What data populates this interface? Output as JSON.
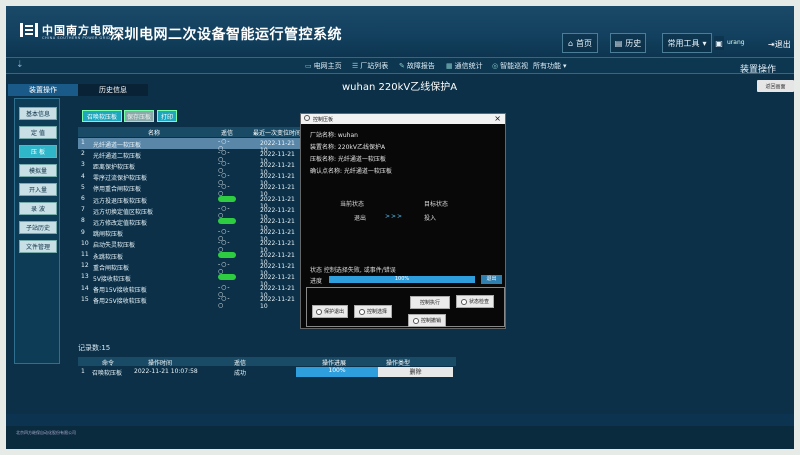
{
  "header": {
    "logo_cn": "中国南方电网",
    "logo_en": "CHINA SOUTHERN POWER GRID",
    "system_title": "深圳电网二次设备智能运行管控系统",
    "home": "首页",
    "history": "历史",
    "common_tools": "常用工具",
    "user": "urang",
    "exit": "退出"
  },
  "menubar": {
    "items": [
      "电网主页",
      "厂站列表",
      "故障报告",
      "通信统计",
      "智能巡视",
      "所有功能"
    ]
  },
  "page": {
    "title": "wuhan 220kV乙线保护A",
    "ops_title": "装置操作",
    "return": "返回画面",
    "tabs": [
      "装置操作",
      "历史信息"
    ]
  },
  "leftnav": {
    "items": [
      "基本信息",
      "定 值",
      "压 板",
      "模拟量",
      "开入量",
      "录 波",
      "子站历史",
      "文件管理"
    ],
    "active_index": 2
  },
  "actions": [
    "召唤软压板",
    "保存压板",
    "打印"
  ],
  "grid": {
    "headers": [
      "名称",
      "遥信",
      "最近一次变位时间"
    ],
    "rows": [
      {
        "num": "1",
        "name": "光纤通道一软压板",
        "state": "off",
        "time": "2022-11-21 10"
      },
      {
        "num": "2",
        "name": "光纤通道二软压板",
        "state": "off",
        "time": "2022-11-21 10"
      },
      {
        "num": "3",
        "name": "距离保护软压板",
        "state": "off",
        "time": "2022-11-21 10"
      },
      {
        "num": "4",
        "name": "零序过流保护软压板",
        "state": "off",
        "time": "2022-11-21 10"
      },
      {
        "num": "5",
        "name": "停用重合闸软压板",
        "state": "off",
        "time": "2022-11-21 10"
      },
      {
        "num": "6",
        "name": "远方投退压板软压板",
        "state": "on",
        "time": "2022-11-21 10"
      },
      {
        "num": "7",
        "name": "远方切换定值区软压板",
        "state": "off",
        "time": "2022-11-21 10"
      },
      {
        "num": "8",
        "name": "远方修改定值软压板",
        "state": "on",
        "time": "2022-11-21 10"
      },
      {
        "num": "9",
        "name": "跳闸软压板",
        "state": "off",
        "time": "2022-11-21 10"
      },
      {
        "num": "10",
        "name": "启动失灵软压板",
        "state": "off",
        "time": "2022-11-21 10"
      },
      {
        "num": "11",
        "name": "永跳软压板",
        "state": "on",
        "time": "2022-11-21 10"
      },
      {
        "num": "12",
        "name": "重合闸软压板",
        "state": "off",
        "time": "2022-11-21 10"
      },
      {
        "num": "13",
        "name": "5V接收软压板",
        "state": "on",
        "time": "2022-11-21 10"
      },
      {
        "num": "14",
        "name": "备用15V接收软压板",
        "state": "off",
        "time": "2022-11-21 10"
      },
      {
        "num": "15",
        "name": "备用25V接收软压板",
        "state": "off",
        "time": "2022-11-21 10"
      }
    ]
  },
  "log": {
    "record_count": "记录数:15",
    "headers": [
      "命令",
      "操作时间",
      "遥信",
      "操作进展",
      "操作类型"
    ],
    "row": {
      "num": "1",
      "cmd": "召唤软压板",
      "time": "2022-11-21 10:07:58",
      "result": "成功",
      "progress": "100%",
      "type": "删除"
    }
  },
  "dialog": {
    "title": "控制压板",
    "lines": [
      "厂站名称: wuhan",
      "装置名称: 220kV乙线保护A",
      "压板名称: 光纤通道一软压板",
      "确认点名称: 光纤通道一软压板"
    ],
    "current_state_label": "当前状态",
    "target_state_label": "目标状态",
    "current_state": "退出",
    "target_state": "投入",
    "arrow": ">>>",
    "status": "状态  控制选择失败, 或事件/错误",
    "progress_label": "进度",
    "progress_value": "100%",
    "exit": "退出",
    "buttons": [
      "控制执行",
      "状态检查",
      "保护退出",
      "控制选择",
      "控制撤销"
    ]
  },
  "footer": {
    "company": "北京四方继保自动化股份有限公司"
  }
}
